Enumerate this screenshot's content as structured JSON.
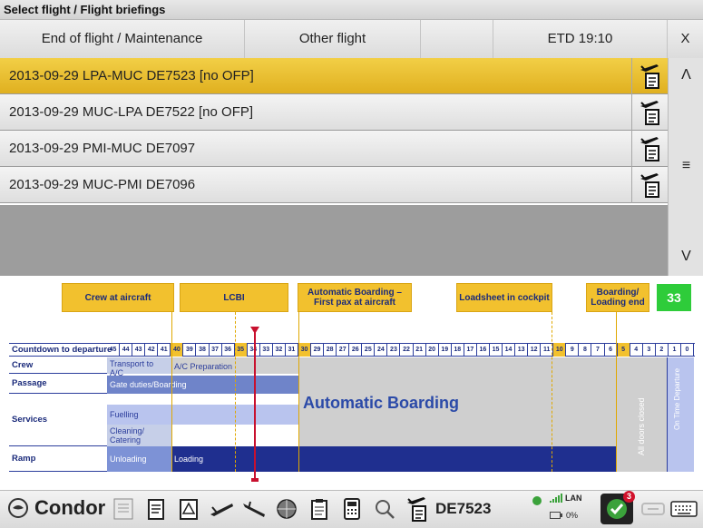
{
  "window": {
    "title": "Select flight / Flight briefings"
  },
  "tabs": [
    "End of flight / Maintenance",
    "Other flight",
    "",
    "ETD 19:10",
    "X"
  ],
  "flights": [
    {
      "label": "2013-09-29 LPA-MUC DE7523 [no OFP]",
      "selected": true
    },
    {
      "label": "2013-09-29 MUC-LPA DE7522 [no OFP]",
      "selected": false
    },
    {
      "label": "2013-09-29 PMI-MUC DE7097",
      "selected": false
    },
    {
      "label": "2013-09-29 MUC-PMI DE7096",
      "selected": false
    }
  ],
  "scroll": {
    "up": "Λ",
    "middle": "≡",
    "down": "V"
  },
  "timeline": {
    "milestones": [
      "Crew at aircraft",
      "LCBI",
      "Automatic Boarding – First pax at aircraft",
      "Loadsheet in cockpit",
      "Boarding/ Loading end"
    ],
    "countdown": "33",
    "header_label": "Countdown to departure",
    "ticks": [
      "45",
      "44",
      "43",
      "42",
      "41",
      "40",
      "39",
      "38",
      "37",
      "36",
      "35",
      "34",
      "33",
      "32",
      "31",
      "30",
      "29",
      "28",
      "27",
      "26",
      "25",
      "24",
      "23",
      "22",
      "21",
      "20",
      "19",
      "18",
      "17",
      "16",
      "15",
      "14",
      "13",
      "12",
      "11",
      "10",
      "9",
      "8",
      "7",
      "6",
      "5",
      "4",
      "3",
      "2",
      "1",
      "0"
    ],
    "rows": [
      "Crew",
      "Passage",
      "Services",
      "Ramp"
    ],
    "bars": {
      "transport": "Transport to A/C",
      "ac_prep": "A/C Preparation",
      "gate": "Gate duties/Boarding",
      "fuelling": "Fuelling",
      "cleaning": "Cleaning/ Catering",
      "unloading": "Unloading",
      "loading": "Loading",
      "auto_boarding": "Automatic Boarding",
      "doors": "All doors closed",
      "ontime": "On Time Departure"
    }
  },
  "taskbar": {
    "brand": "Condor",
    "flight": "DE7523",
    "network": "LAN",
    "battery": "0%",
    "badge": "3"
  },
  "colors": {
    "accent": "#f2c12e",
    "navy": "#1f2f8f",
    "green": "#2ecc3a"
  }
}
